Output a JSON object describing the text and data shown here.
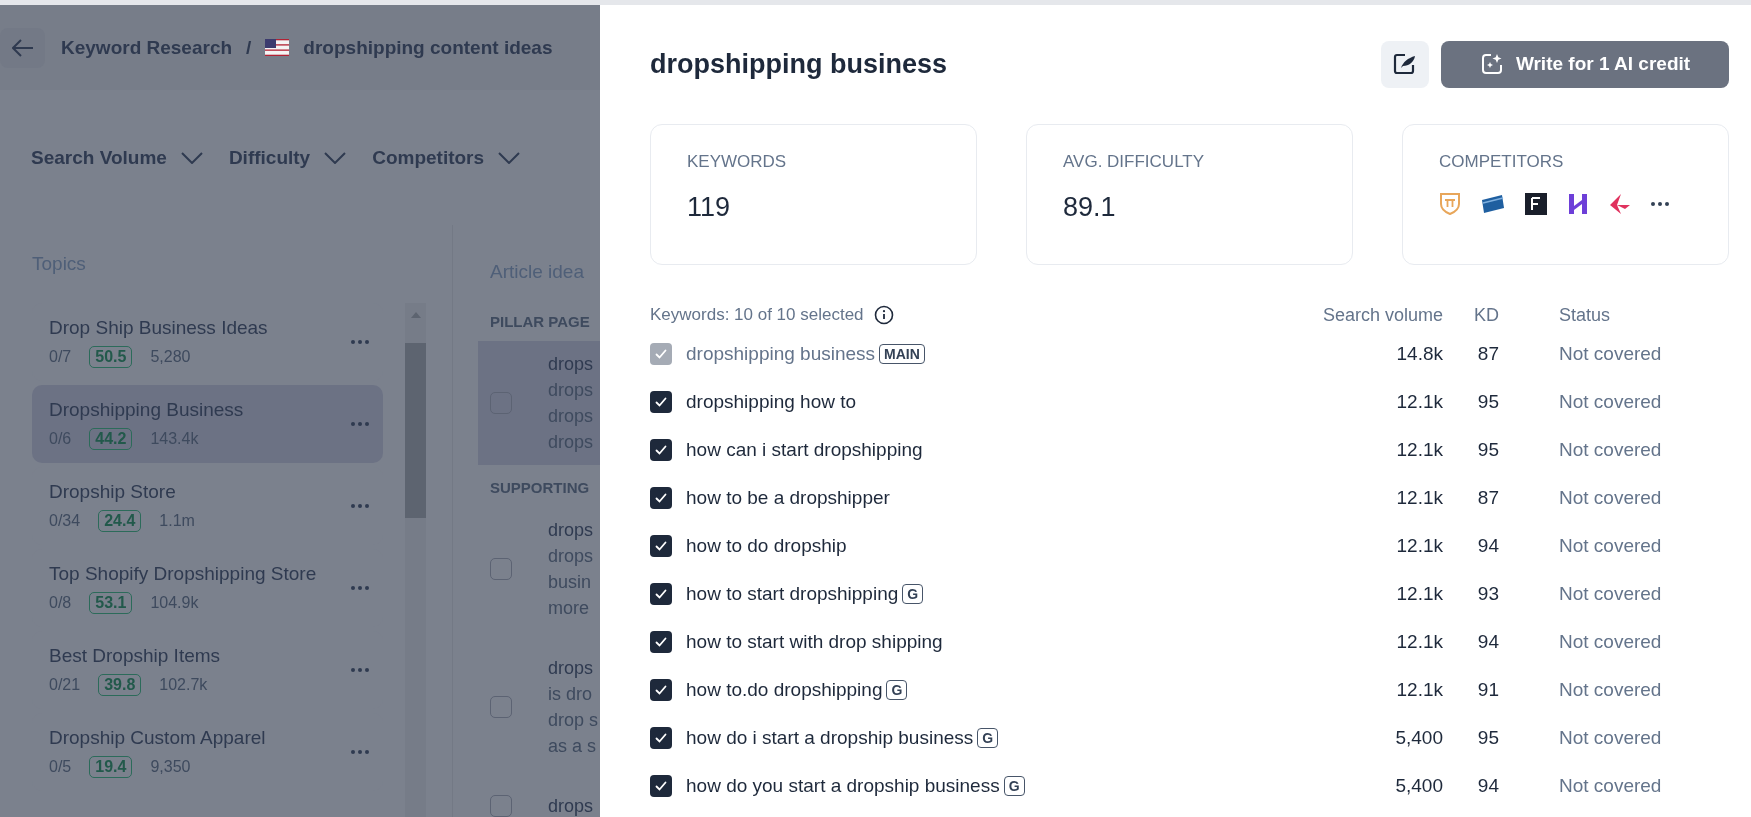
{
  "breadcrumb": {
    "section": "Keyword Research",
    "separator": "/",
    "project": "dropshipping content ideas"
  },
  "filters": [
    {
      "label": "Search Volume"
    },
    {
      "label": "Difficulty"
    },
    {
      "label": "Competitors"
    }
  ],
  "topics": {
    "title": "Topics",
    "items": [
      {
        "name": "Drop Ship Business Ideas",
        "progress": "0/7",
        "difficulty": "50.5",
        "volume": "5,280",
        "selected": false
      },
      {
        "name": "Dropshipping Business",
        "progress": "0/6",
        "difficulty": "44.2",
        "volume": "143.4k",
        "selected": true
      },
      {
        "name": "Dropship Store",
        "progress": "0/34",
        "difficulty": "24.4",
        "volume": "1.1m",
        "selected": false
      },
      {
        "name": "Top Shopify Dropshipping Store",
        "progress": "0/8",
        "difficulty": "53.1",
        "volume": "104.9k",
        "selected": false
      },
      {
        "name": "Best Dropship Items",
        "progress": "0/21",
        "difficulty": "39.8",
        "volume": "102.7k",
        "selected": false
      },
      {
        "name": "Dropship Custom Apparel",
        "progress": "0/5",
        "difficulty": "19.4",
        "volume": "9,350",
        "selected": false
      }
    ]
  },
  "articles": {
    "title": "Article idea",
    "groups": [
      {
        "title": "PILLAR PAGE",
        "items": [
          {
            "title": "drops",
            "lines": [
              "drops",
              "drops",
              "drops"
            ],
            "highlighted": true,
            "checked": false
          }
        ]
      },
      {
        "title": "SUPPORTING",
        "items": [
          {
            "title": "drops",
            "lines": [
              "drops",
              "busin",
              "more"
            ],
            "highlighted": false,
            "checked": false
          },
          {
            "title": "drops",
            "lines": [
              "is dro",
              "drop s",
              "as a s"
            ],
            "highlighted": false,
            "checked": false
          },
          {
            "title": "drops",
            "highlighted": false,
            "checked": false
          }
        ]
      }
    ]
  },
  "drawer": {
    "title": "dropshipping business",
    "write_button": "Write for 1 AI credit",
    "stats": [
      {
        "kind": "value",
        "label": "KEYWORDS",
        "value": "119"
      },
      {
        "kind": "value",
        "label": "AVG. DIFFICULTY",
        "value": "89.1"
      },
      {
        "kind": "logos",
        "label": "COMPETITORS"
      }
    ],
    "keywords": {
      "summary": "Keywords: 10 of 10 selected",
      "columns": [
        "Search volume",
        "KD",
        "Status"
      ],
      "rows": [
        {
          "keyword": "dropshipping business",
          "tag": "MAIN",
          "volume": "14.8k",
          "kd": "87",
          "status": "Not covered",
          "checked": true,
          "disabled": true
        },
        {
          "keyword": "dropshipping how to",
          "volume": "12.1k",
          "kd": "95",
          "status": "Not covered",
          "checked": true,
          "disabled": false
        },
        {
          "keyword": "how can i start dropshipping",
          "volume": "12.1k",
          "kd": "95",
          "status": "Not covered",
          "checked": true,
          "disabled": false
        },
        {
          "keyword": "how to be a dropshipper",
          "volume": "12.1k",
          "kd": "87",
          "status": "Not covered",
          "checked": true,
          "disabled": false
        },
        {
          "keyword": "how to do dropship",
          "volume": "12.1k",
          "kd": "94",
          "status": "Not covered",
          "checked": true,
          "disabled": false
        },
        {
          "keyword": "how to start dropshipping",
          "tag": "G",
          "volume": "12.1k",
          "kd": "93",
          "status": "Not covered",
          "checked": true,
          "disabled": false
        },
        {
          "keyword": "how to start with drop shipping",
          "volume": "12.1k",
          "kd": "94",
          "status": "Not covered",
          "checked": true,
          "disabled": false
        },
        {
          "keyword": "how to.do dropshipping",
          "tag": "G",
          "volume": "12.1k",
          "kd": "91",
          "status": "Not covered",
          "checked": true,
          "disabled": false
        },
        {
          "keyword": "how do i start a dropship business",
          "tag": "G",
          "volume": "5,400",
          "kd": "95",
          "status": "Not covered",
          "checked": true,
          "disabled": false
        },
        {
          "keyword": "how do you start a dropship business",
          "tag": "G",
          "volume": "5,400",
          "kd": "94",
          "status": "Not covered",
          "checked": true,
          "disabled": false
        }
      ]
    }
  }
}
